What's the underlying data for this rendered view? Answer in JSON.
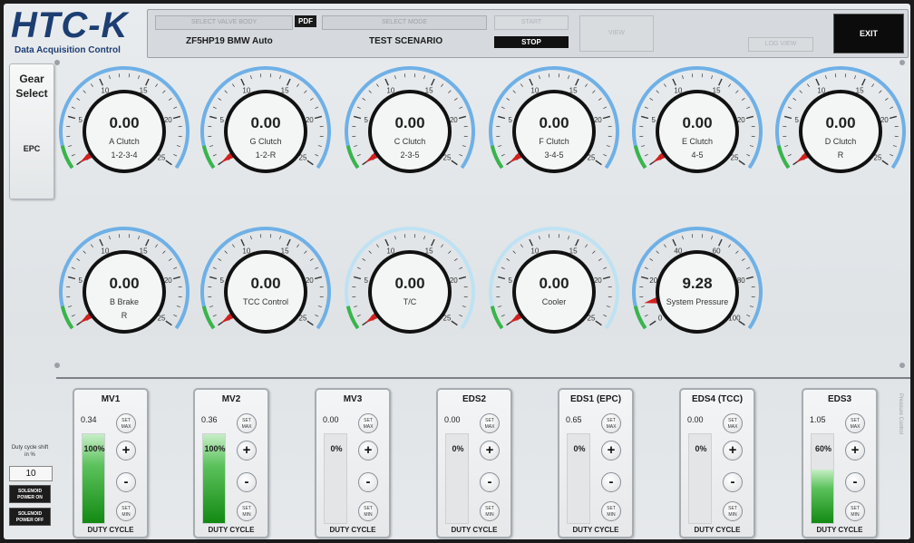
{
  "header": {
    "logo": "HTC-K",
    "subtitle": "Data Acquisition Control",
    "valve_body_placeholder": "SELECT VALVE BODY",
    "pdf_label": "PDF",
    "valve_body_value": "ZF5HP19 BMW Auto",
    "mode_placeholder": "SELECT MODE",
    "mode_value": "TEST SCENARIO",
    "start_label": "START",
    "stop_label": "STOP",
    "view_label": "VIEW",
    "log_view_label": "LOG VIEW",
    "exit_label": "EXIT"
  },
  "side": {
    "gear_label": "Gear Select",
    "epc_label": "EPC",
    "duty_label": "Duty cycle shift in %",
    "duty_value": "10",
    "power_on_label": "SOLENOID POWER ON",
    "power_off_label": "SOLENOID POWER OFF",
    "rotated_text": "Pressure Control"
  },
  "gauges": [
    {
      "value": "0.00",
      "name": "A Clutch",
      "sub": "1-2-3-4",
      "min": 0,
      "max": 25,
      "labels": [
        "0",
        "5",
        "10",
        "15",
        "20",
        "25"
      ],
      "reading": 0
    },
    {
      "value": "0.00",
      "name": "G Clutch",
      "sub": "1-2-R",
      "min": 0,
      "max": 25,
      "labels": [
        "0",
        "5",
        "10",
        "15",
        "20",
        "25"
      ],
      "reading": 0
    },
    {
      "value": "0.00",
      "name": "C Clutch",
      "sub": "2-3-5",
      "min": 0,
      "max": 25,
      "labels": [
        "0",
        "5",
        "10",
        "15",
        "20",
        "25"
      ],
      "reading": 0
    },
    {
      "value": "0.00",
      "name": "F Clutch",
      "sub": "3-4-5",
      "min": 0,
      "max": 25,
      "labels": [
        "0",
        "5",
        "10",
        "15",
        "20",
        "25"
      ],
      "reading": 0
    },
    {
      "value": "0.00",
      "name": "E Clutch",
      "sub": "4-5",
      "min": 0,
      "max": 25,
      "labels": [
        "0",
        "5",
        "10",
        "15",
        "20",
        "25"
      ],
      "reading": 0
    },
    {
      "value": "0.00",
      "name": "D Clutch",
      "sub": "R",
      "min": 0,
      "max": 25,
      "labels": [
        "0",
        "5",
        "10",
        "15",
        "20",
        "25"
      ],
      "reading": 0
    },
    {
      "value": "0.00",
      "name": "B Brake",
      "sub": "R",
      "min": 0,
      "max": 25,
      "labels": [
        "0",
        "5",
        "10",
        "15",
        "20",
        "25"
      ],
      "reading": 0
    },
    {
      "value": "0.00",
      "name": "TCC Control",
      "sub": "",
      "min": 0,
      "max": 25,
      "labels": [
        "0",
        "5",
        "10",
        "15",
        "20",
        "25"
      ],
      "reading": 0
    },
    {
      "value": "0.00",
      "name": "T/C",
      "sub": "",
      "min": 0,
      "max": 25,
      "labels": [
        "0",
        "5",
        "10",
        "15",
        "20",
        "25"
      ],
      "reading": 0
    },
    {
      "value": "0.00",
      "name": "Cooler",
      "sub": "",
      "min": 0,
      "max": 25,
      "labels": [
        "0",
        "5",
        "10",
        "15",
        "20",
        "25"
      ],
      "reading": 0
    },
    {
      "value": "9.28",
      "name": "System Pressure",
      "sub": "",
      "min": 0,
      "max": 100,
      "labels": [
        "0",
        "20",
        "40",
        "60",
        "80",
        "100"
      ],
      "reading": 9.28
    }
  ],
  "colors": {
    "arc_blue": "#6fb0e6",
    "arc_light": "#bfe2f3",
    "green": "#39b54a",
    "needle": "#d32020",
    "ring": "#111111"
  },
  "solenoids": [
    {
      "title": "MV1",
      "value": "0.34",
      "pct": "100%",
      "fill": 1.0
    },
    {
      "title": "MV2",
      "value": "0.36",
      "pct": "100%",
      "fill": 1.0
    },
    {
      "title": "MV3",
      "value": "0.00",
      "pct": "0%",
      "fill": 0.0
    },
    {
      "title": "EDS2",
      "value": "0.00",
      "pct": "0%",
      "fill": 0.0
    },
    {
      "title": "EDS1 (EPC)",
      "value": "0.65",
      "pct": "0%",
      "fill": 0.0
    },
    {
      "title": "EDS4 (TCC)",
      "value": "0.00",
      "pct": "0%",
      "fill": 0.0
    },
    {
      "title": "EDS3",
      "value": "1.05",
      "pct": "60%",
      "fill": 0.6
    }
  ],
  "solenoid_labels": {
    "set_max": "SET MAX",
    "set_min": "SET MIN",
    "plus": "+",
    "minus": "-",
    "footer": "DUTY CYCLE"
  }
}
